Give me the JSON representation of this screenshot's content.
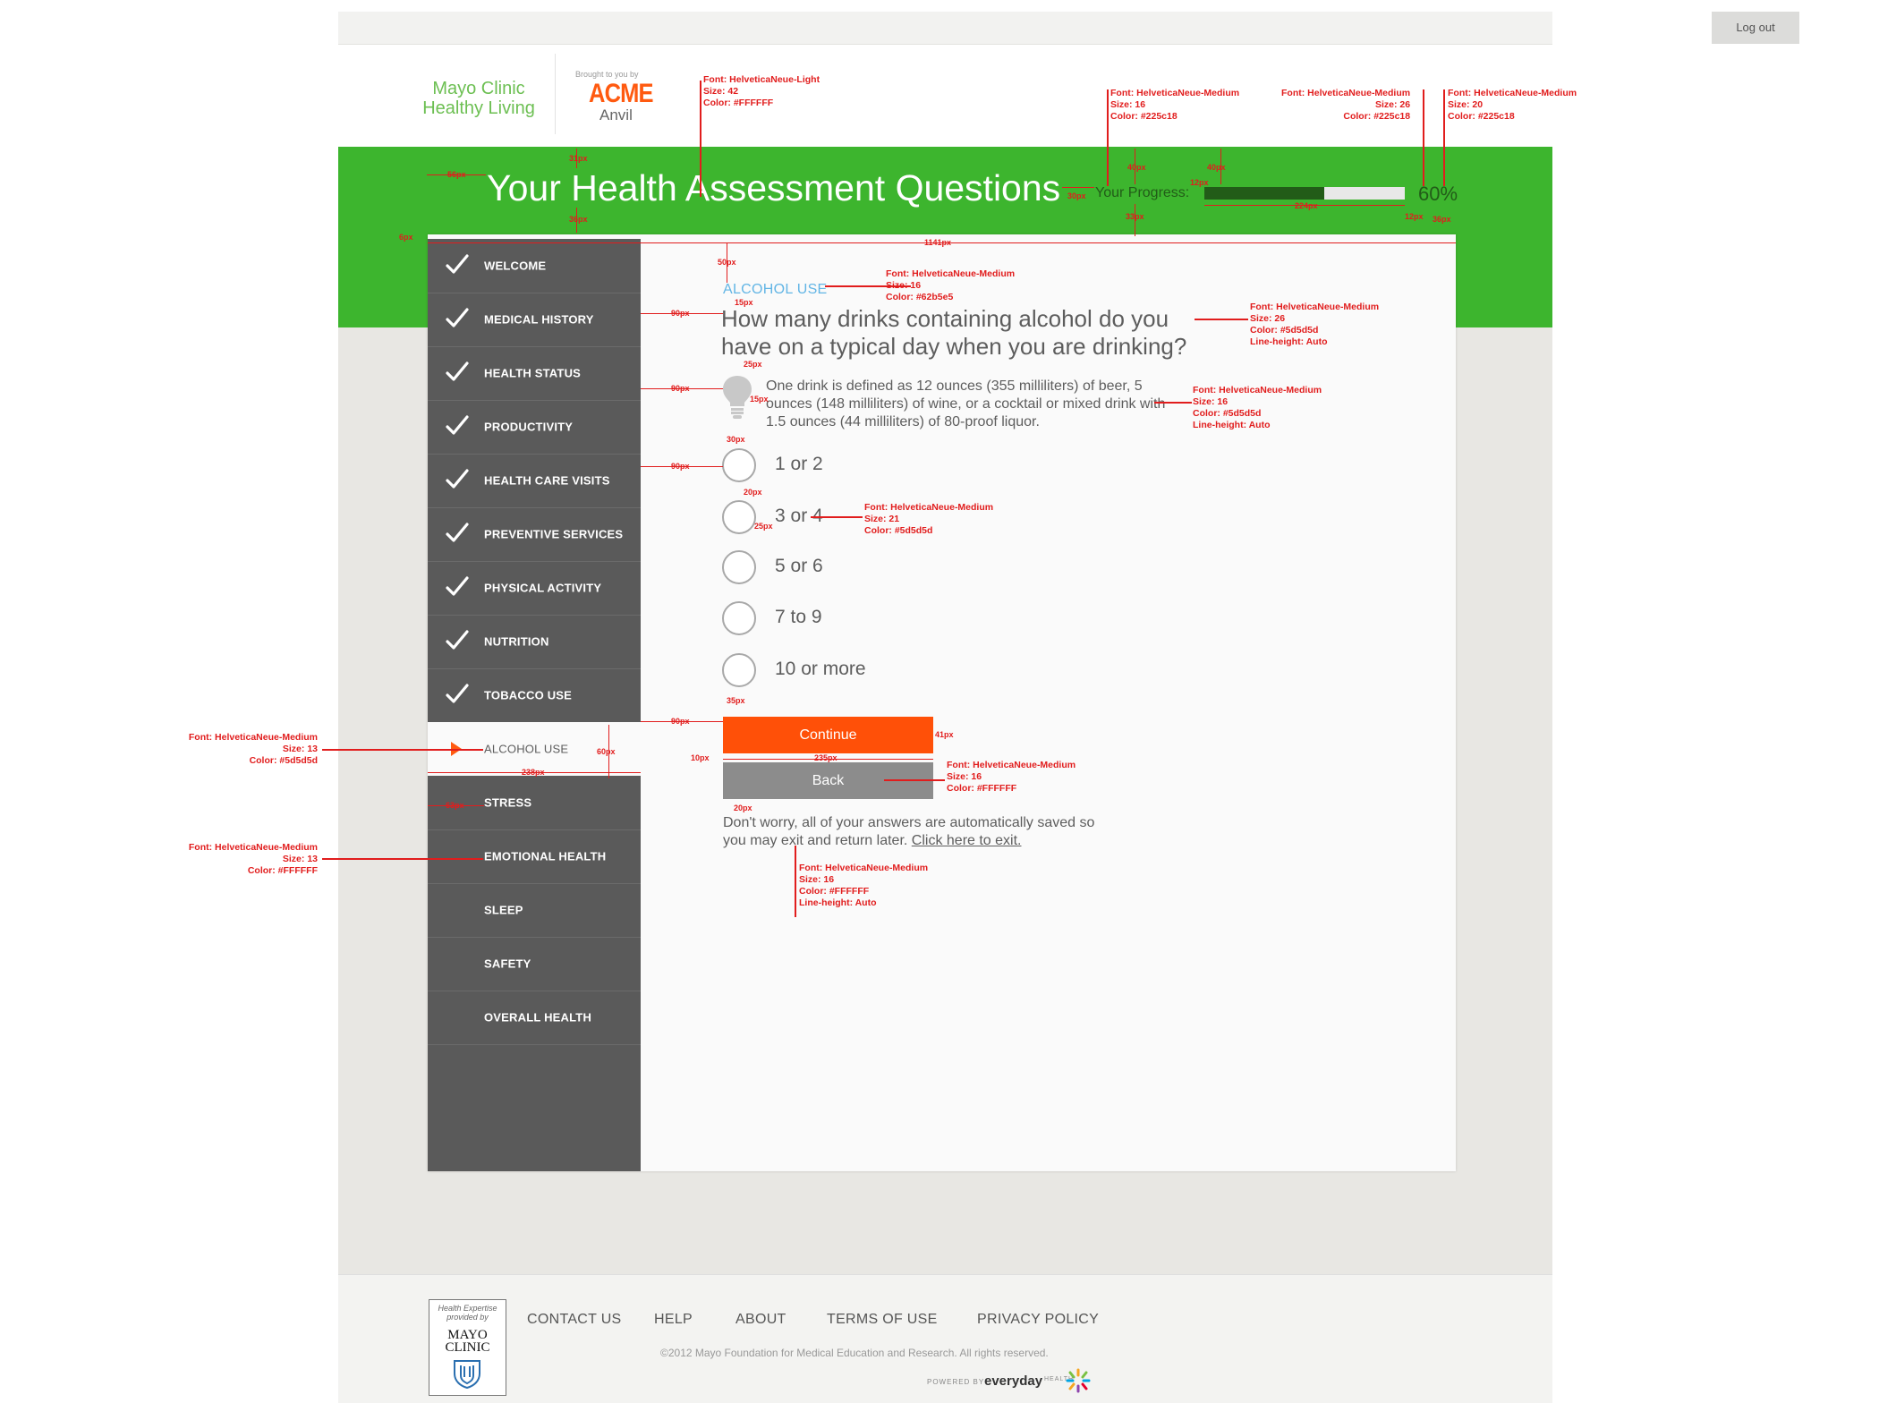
{
  "topbar": {
    "logout_label": "Log out"
  },
  "brand": {
    "mayo_line1": "Mayo Clinic",
    "mayo_line2": "Healthy Living",
    "brought_by": "Brought to you by",
    "acme": "ACME",
    "anvil": "Anvil"
  },
  "header": {
    "title": "Your Health Assessment Questions",
    "progress_label": "Your Progress:",
    "progress_value": 60,
    "progress_text": "60%"
  },
  "sidebar": {
    "items": [
      {
        "label": "WELCOME",
        "state": "done"
      },
      {
        "label": "MEDICAL HISTORY",
        "state": "done"
      },
      {
        "label": "HEALTH STATUS",
        "state": "done"
      },
      {
        "label": "PRODUCTIVITY",
        "state": "done"
      },
      {
        "label": "HEALTH CARE VISITS",
        "state": "done"
      },
      {
        "label": "PREVENTIVE SERVICES",
        "state": "done"
      },
      {
        "label": "PHYSICAL ACTIVITY",
        "state": "done"
      },
      {
        "label": "NUTRITION",
        "state": "done"
      },
      {
        "label": "TOBACCO USE",
        "state": "done"
      },
      {
        "label": "ALCOHOL USE",
        "state": "active"
      },
      {
        "label": "STRESS",
        "state": "todo"
      },
      {
        "label": "EMOTIONAL HEALTH",
        "state": "todo"
      },
      {
        "label": "SLEEP",
        "state": "todo"
      },
      {
        "label": "SAFETY",
        "state": "todo"
      },
      {
        "label": "OVERALL HEALTH",
        "state": "todo"
      }
    ]
  },
  "question": {
    "section": "ALCOHOL USE",
    "text": "How many drinks containing alcohol do you have on a typical day when you are drinking?",
    "hint": "One drink is defined as 12 ounces (355 milliliters) of beer, 5 ounces (148 milliliters) of wine, or a cocktail or mixed drink with 1.5 ounces (44 milliliters) of 80-proof liquor.",
    "options": [
      "1 or 2",
      "3 or 4",
      "5 or 6",
      "7 to 9",
      "10 or more"
    ],
    "continue_label": "Continue",
    "back_label": "Back",
    "autosave_text": "Don't worry, all of your answers are automatically saved so you may exit and return later.",
    "exit_link": "Click here to exit."
  },
  "footer": {
    "badge_text": "Health Expertise provided by",
    "badge_logo_1": "MAYO",
    "badge_logo_2": "CLINIC",
    "links": [
      "CONTACT US",
      "HELP",
      "ABOUT",
      "TERMS OF USE",
      "PRIVACY POLICY"
    ],
    "copyright": "©2012 Mayo Foundation for Medical Education and Research. All rights reserved.",
    "powered_by": "POWERED BY",
    "everyday": "everyday",
    "health": "HEALTH"
  },
  "annotations": {
    "title_font": [
      "Font: HelveticaNeue-Light",
      "Size: 42",
      "Color: #FFFFFF"
    ],
    "progress_label_font": [
      "Font: HelveticaNeue-Medium",
      "Size: 16",
      "Color: #225c18"
    ],
    "progress_pct_font": [
      "Font: HelveticaNeue-Medium",
      "Size: 26",
      "Color: #225c18"
    ],
    "progress_pct_font2": [
      "Font: HelveticaNeue-Medium",
      "Size: 20",
      "Color: #225c18"
    ],
    "section_font": [
      "Font: HelveticaNeue-Medium",
      "Size: 16",
      "Color: #62b5e5"
    ],
    "question_font": [
      "Font: HelveticaNeue-Medium",
      "Size: 26",
      "Color: #5d5d5d",
      "Line-height: Auto"
    ],
    "hint_font": [
      "Font: HelveticaNeue-Medium",
      "Size: 16",
      "Color: #5d5d5d",
      "Line-height: Auto"
    ],
    "option_font": [
      "Font: HelveticaNeue-Medium",
      "Size: 21",
      "Color: #5d5d5d"
    ],
    "active_nav_font": [
      "Font: HelveticaNeue-Medium",
      "Size: 13",
      "Color: #5d5d5d"
    ],
    "nav_font": [
      "Font: HelveticaNeue-Medium",
      "Size: 13",
      "Color: #FFFFFF"
    ],
    "button_font": [
      "Font: HelveticaNeue-Medium",
      "Size: 16",
      "Color: #FFFFFF"
    ],
    "autosave_font": [
      "Font: HelveticaNeue-Medium",
      "Size: 16",
      "Color: #FFFFFF",
      "Line-height: Auto"
    ],
    "dims": {
      "d56": "56px",
      "d31": "31px",
      "d36a": "36px",
      "d6": "6px",
      "d1141": "1141px",
      "d30": "30px",
      "d40a": "40px",
      "d40b": "40px",
      "d12a": "12px",
      "d33": "33px",
      "d224": "224px",
      "d12b": "12px",
      "d36b": "36px",
      "d50": "50px",
      "d15a": "15px",
      "d90a": "90px",
      "d25a": "25px",
      "d90b": "90px",
      "d15b": "15px",
      "d30b": "30px",
      "d90c": "90px",
      "d20a": "20px",
      "d25b": "25px",
      "d35": "35px",
      "d90d": "90px",
      "d41": "41px",
      "d10": "10px",
      "d235": "235px",
      "d60": "60px",
      "d238": "238px",
      "d20b": "20px",
      "d63": "63px"
    }
  },
  "colors": {
    "brand_green": "#3db52e",
    "progress_green": "#225c18",
    "accent_orange": "#ff5008",
    "section_blue": "#62b5e5",
    "text_gray": "#5d5d5d",
    "annotation_red": "#e11d1d"
  }
}
